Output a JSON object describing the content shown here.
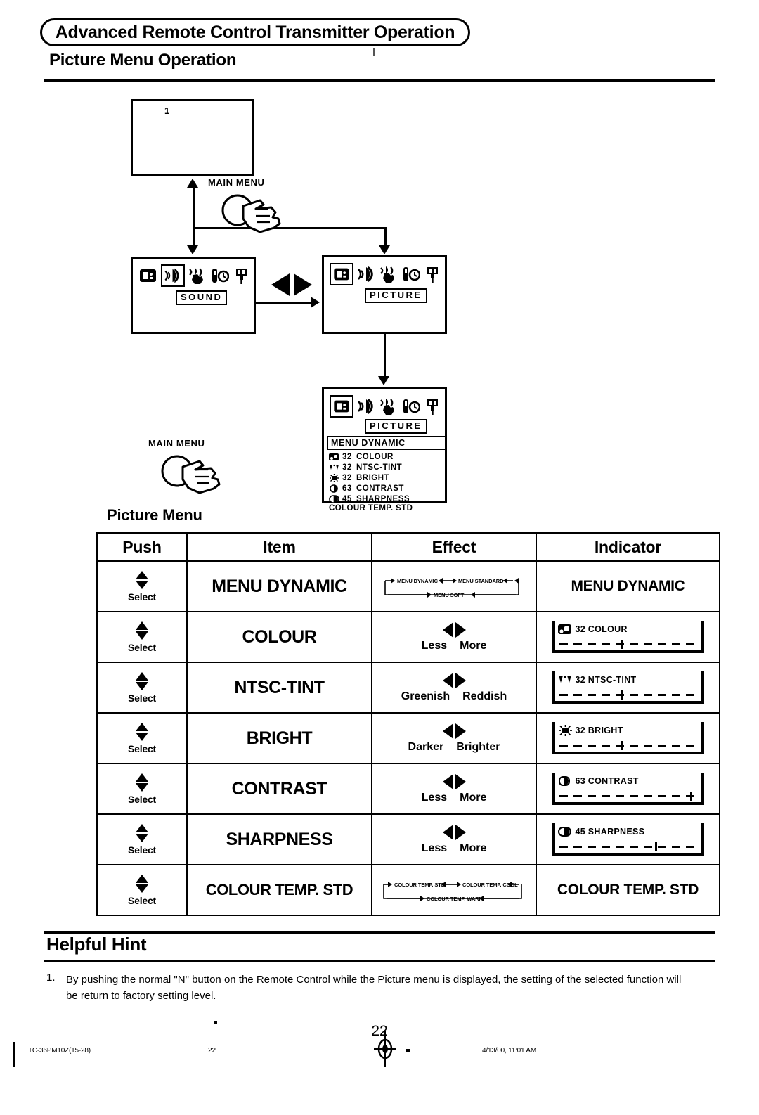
{
  "header": {
    "banner_title": "Advanced Remote Control Transmitter Operation",
    "section_title": "Picture Menu Operation"
  },
  "diagram": {
    "screen1_marker": "1",
    "main_menu_label_top": "MAIN MENU",
    "main_menu_label_bottom": "MAIN MENU",
    "sound_tag": "SOUND",
    "picture_tag": "PICTURE",
    "picture_tag2": "PICTURE",
    "icons": [
      "picture-icon",
      "sound-icon",
      "audio-hand-icon",
      "timer-icon",
      "setup-plug-icon"
    ],
    "osd": {
      "header": "MENU  DYNAMIC",
      "rows": [
        {
          "icon": "colour-icon",
          "value": "32",
          "label": "COLOUR"
        },
        {
          "icon": "tint-icon",
          "value": "32",
          "label": "NTSC-TINT"
        },
        {
          "icon": "bright-icon",
          "value": "32",
          "label": "BRIGHT"
        },
        {
          "icon": "contrast-icon",
          "value": "63",
          "label": "CONTRAST"
        },
        {
          "icon": "sharpness-icon",
          "value": "45",
          "label": "SHARPNESS"
        }
      ],
      "footer": "COLOUR TEMP. STD"
    }
  },
  "table": {
    "caption": "Picture Menu",
    "columns": [
      "Push",
      "Item",
      "Effect",
      "Indicator"
    ],
    "push_label": "Select",
    "rows": [
      {
        "item": "MENU DYNAMIC",
        "effect_type": "cycle",
        "effect_cycle": [
          "MENU DYNAMIC",
          "MENU STANDARD",
          "MENU SOFT"
        ],
        "indicator_type": "text",
        "indicator_text": "MENU DYNAMIC"
      },
      {
        "item": "COLOUR",
        "effect_type": "lr",
        "effect_left": "Less",
        "effect_right": "More",
        "indicator_type": "bar",
        "indicator_icon": "colour-icon",
        "indicator_value": "32",
        "indicator_label": "COLOUR",
        "indicator_percent": 44
      },
      {
        "item": "NTSC-TINT",
        "effect_type": "lr",
        "effect_left": "Greenish",
        "effect_right": "Reddish",
        "indicator_type": "bar",
        "indicator_icon": "tint-icon",
        "indicator_value": "32",
        "indicator_label": "NTSC-TINT",
        "indicator_percent": 44
      },
      {
        "item": "BRIGHT",
        "effect_type": "lr",
        "effect_left": "Darker",
        "effect_right": "Brighter",
        "indicator_type": "bar",
        "indicator_icon": "bright-icon",
        "indicator_value": "32",
        "indicator_label": "BRIGHT",
        "indicator_percent": 44
      },
      {
        "item": "CONTRAST",
        "effect_type": "lr",
        "effect_left": "Less",
        "effect_right": "More",
        "indicator_type": "bar",
        "indicator_icon": "contrast-icon",
        "indicator_value": "63",
        "indicator_label": "CONTRAST",
        "indicator_percent": 92
      },
      {
        "item": "SHARPNESS",
        "effect_type": "lr",
        "effect_left": "Less",
        "effect_right": "More",
        "indicator_type": "bar",
        "indicator_icon": "sharpness-icon",
        "indicator_value": "45",
        "indicator_label": "SHARPNESS",
        "indicator_percent": 68
      },
      {
        "item": "COLOUR TEMP. STD",
        "effect_type": "cycle",
        "effect_cycle": [
          "COLOUR TEMP. STD",
          "COLOUR TEMP. COOL",
          "COLOUR TEMP. WARM"
        ],
        "indicator_type": "text",
        "indicator_text": "COLOUR TEMP. STD"
      }
    ]
  },
  "hint": {
    "title": "Helpful Hint",
    "number": "1.",
    "body": "By pushing the normal \"N\" button on the Remote Control while the Picture menu is displayed, the setting of the selected function will be return to factory setting level."
  },
  "footer": {
    "page_number": "22",
    "doc_code": "TC-36PM10Z(15-28)",
    "foot_page": "22",
    "timestamp": "4/13/00, 11:01 AM"
  }
}
